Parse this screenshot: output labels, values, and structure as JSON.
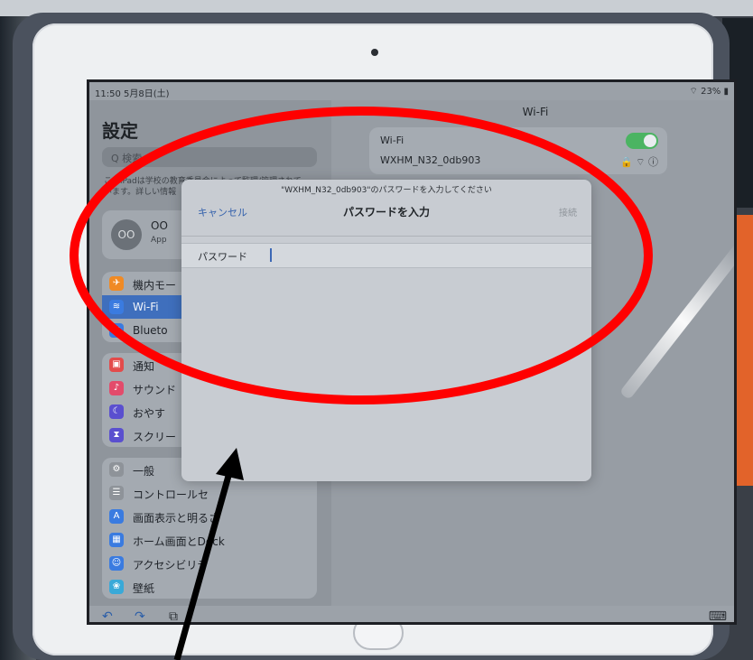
{
  "status_bar": {
    "time": "11:50 5月8日(土)",
    "battery": "23%"
  },
  "sidebar": {
    "title": "設定",
    "search_placeholder": "Q 検索",
    "note": "このiPadは学校の教育委員会によって監理/管理されています。詳しい情報",
    "profile": {
      "initials": "OO",
      "name": "OO",
      "sub": "App"
    },
    "items": [
      {
        "label": "機内モー",
        "icon": "airplane-icon",
        "color": "#f08a24"
      },
      {
        "label": "Wi-Fi",
        "icon": "wifi-icon",
        "color": "#3a7be0",
        "active": true
      },
      {
        "label": "Blueto",
        "icon": "bluetooth-icon",
        "color": "#3a7be0"
      },
      {
        "label": "通知",
        "icon": "notifications-icon",
        "color": "#e34b4b"
      },
      {
        "label": "サウンド",
        "icon": "sound-icon",
        "color": "#e34b6b"
      },
      {
        "label": "おやす",
        "icon": "moon-icon",
        "color": "#5a4fcf"
      },
      {
        "label": "スクリー",
        "icon": "hourglass-icon",
        "color": "#5a4fcf"
      },
      {
        "label": "一般",
        "icon": "gear-icon",
        "color": "#8e9399"
      },
      {
        "label": "コントロールセ",
        "icon": "control-center-icon",
        "color": "#8e9399"
      },
      {
        "label": "画面表示と明るさ",
        "icon": "display-icon",
        "color": "#3a7be0"
      },
      {
        "label": "ホーム画面とDock",
        "icon": "home-screen-icon",
        "color": "#3a7be0"
      },
      {
        "label": "アクセシビリテ",
        "icon": "accessibility-icon",
        "color": "#3a7be0"
      },
      {
        "label": "壁紙",
        "icon": "wallpaper-icon",
        "color": "#39a9d8"
      }
    ]
  },
  "detail": {
    "title": "Wi-Fi",
    "wifi_label": "Wi-Fi",
    "network_name": "WXHM_N32_0db903",
    "network_indicators": "🔒 ⌔ ⓘ"
  },
  "modal": {
    "prompt": "\"WXHM_N32_0db903\"のパスワードを入力してください",
    "cancel_label": "キャンセル",
    "title": "パスワードを入力",
    "join_label": "接続",
    "password_label": "パスワード",
    "password_value": ""
  },
  "bottom_toolbar": {
    "undo": "↶",
    "redo": "↷",
    "clipboard": "⧉",
    "keyboard": "⌨"
  },
  "annotation": {
    "ellipse_color": "#ff0000",
    "arrow_color": "#000000"
  }
}
